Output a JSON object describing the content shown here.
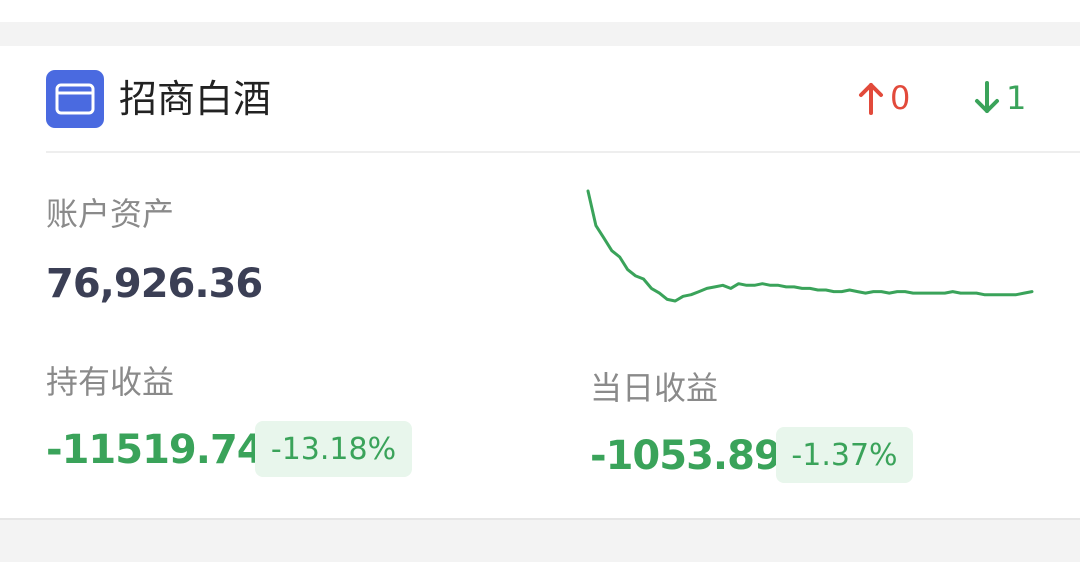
{
  "fund": {
    "icon": "wallet-icon",
    "name": "招商白酒",
    "up_count": "0",
    "down_count": "1"
  },
  "assets": {
    "label": "账户资产",
    "value": "76,926.36"
  },
  "holding_gain": {
    "label": "持有收益",
    "value": "-11519.74",
    "percent": "-13.18%"
  },
  "daily_gain": {
    "label": "当日收益",
    "value": "-1053.89",
    "percent": "-1.37%"
  },
  "colors": {
    "up": "#e24a3b",
    "down": "#3aa35a",
    "icon_bg": "#4a6ae0"
  },
  "sparkline": {
    "values": [
      100,
      78,
      70,
      62,
      58,
      50,
      46,
      44,
      38,
      35,
      31,
      30,
      33,
      34,
      36,
      38,
      39,
      40,
      38,
      41,
      40,
      40,
      41,
      40,
      40,
      39,
      39,
      38,
      38,
      37,
      37,
      36,
      36,
      37,
      36,
      35,
      36,
      36,
      35,
      36,
      36,
      35,
      35,
      35,
      35,
      35,
      36,
      35,
      35,
      35,
      34,
      34,
      34,
      34,
      34,
      35,
      36
    ]
  }
}
